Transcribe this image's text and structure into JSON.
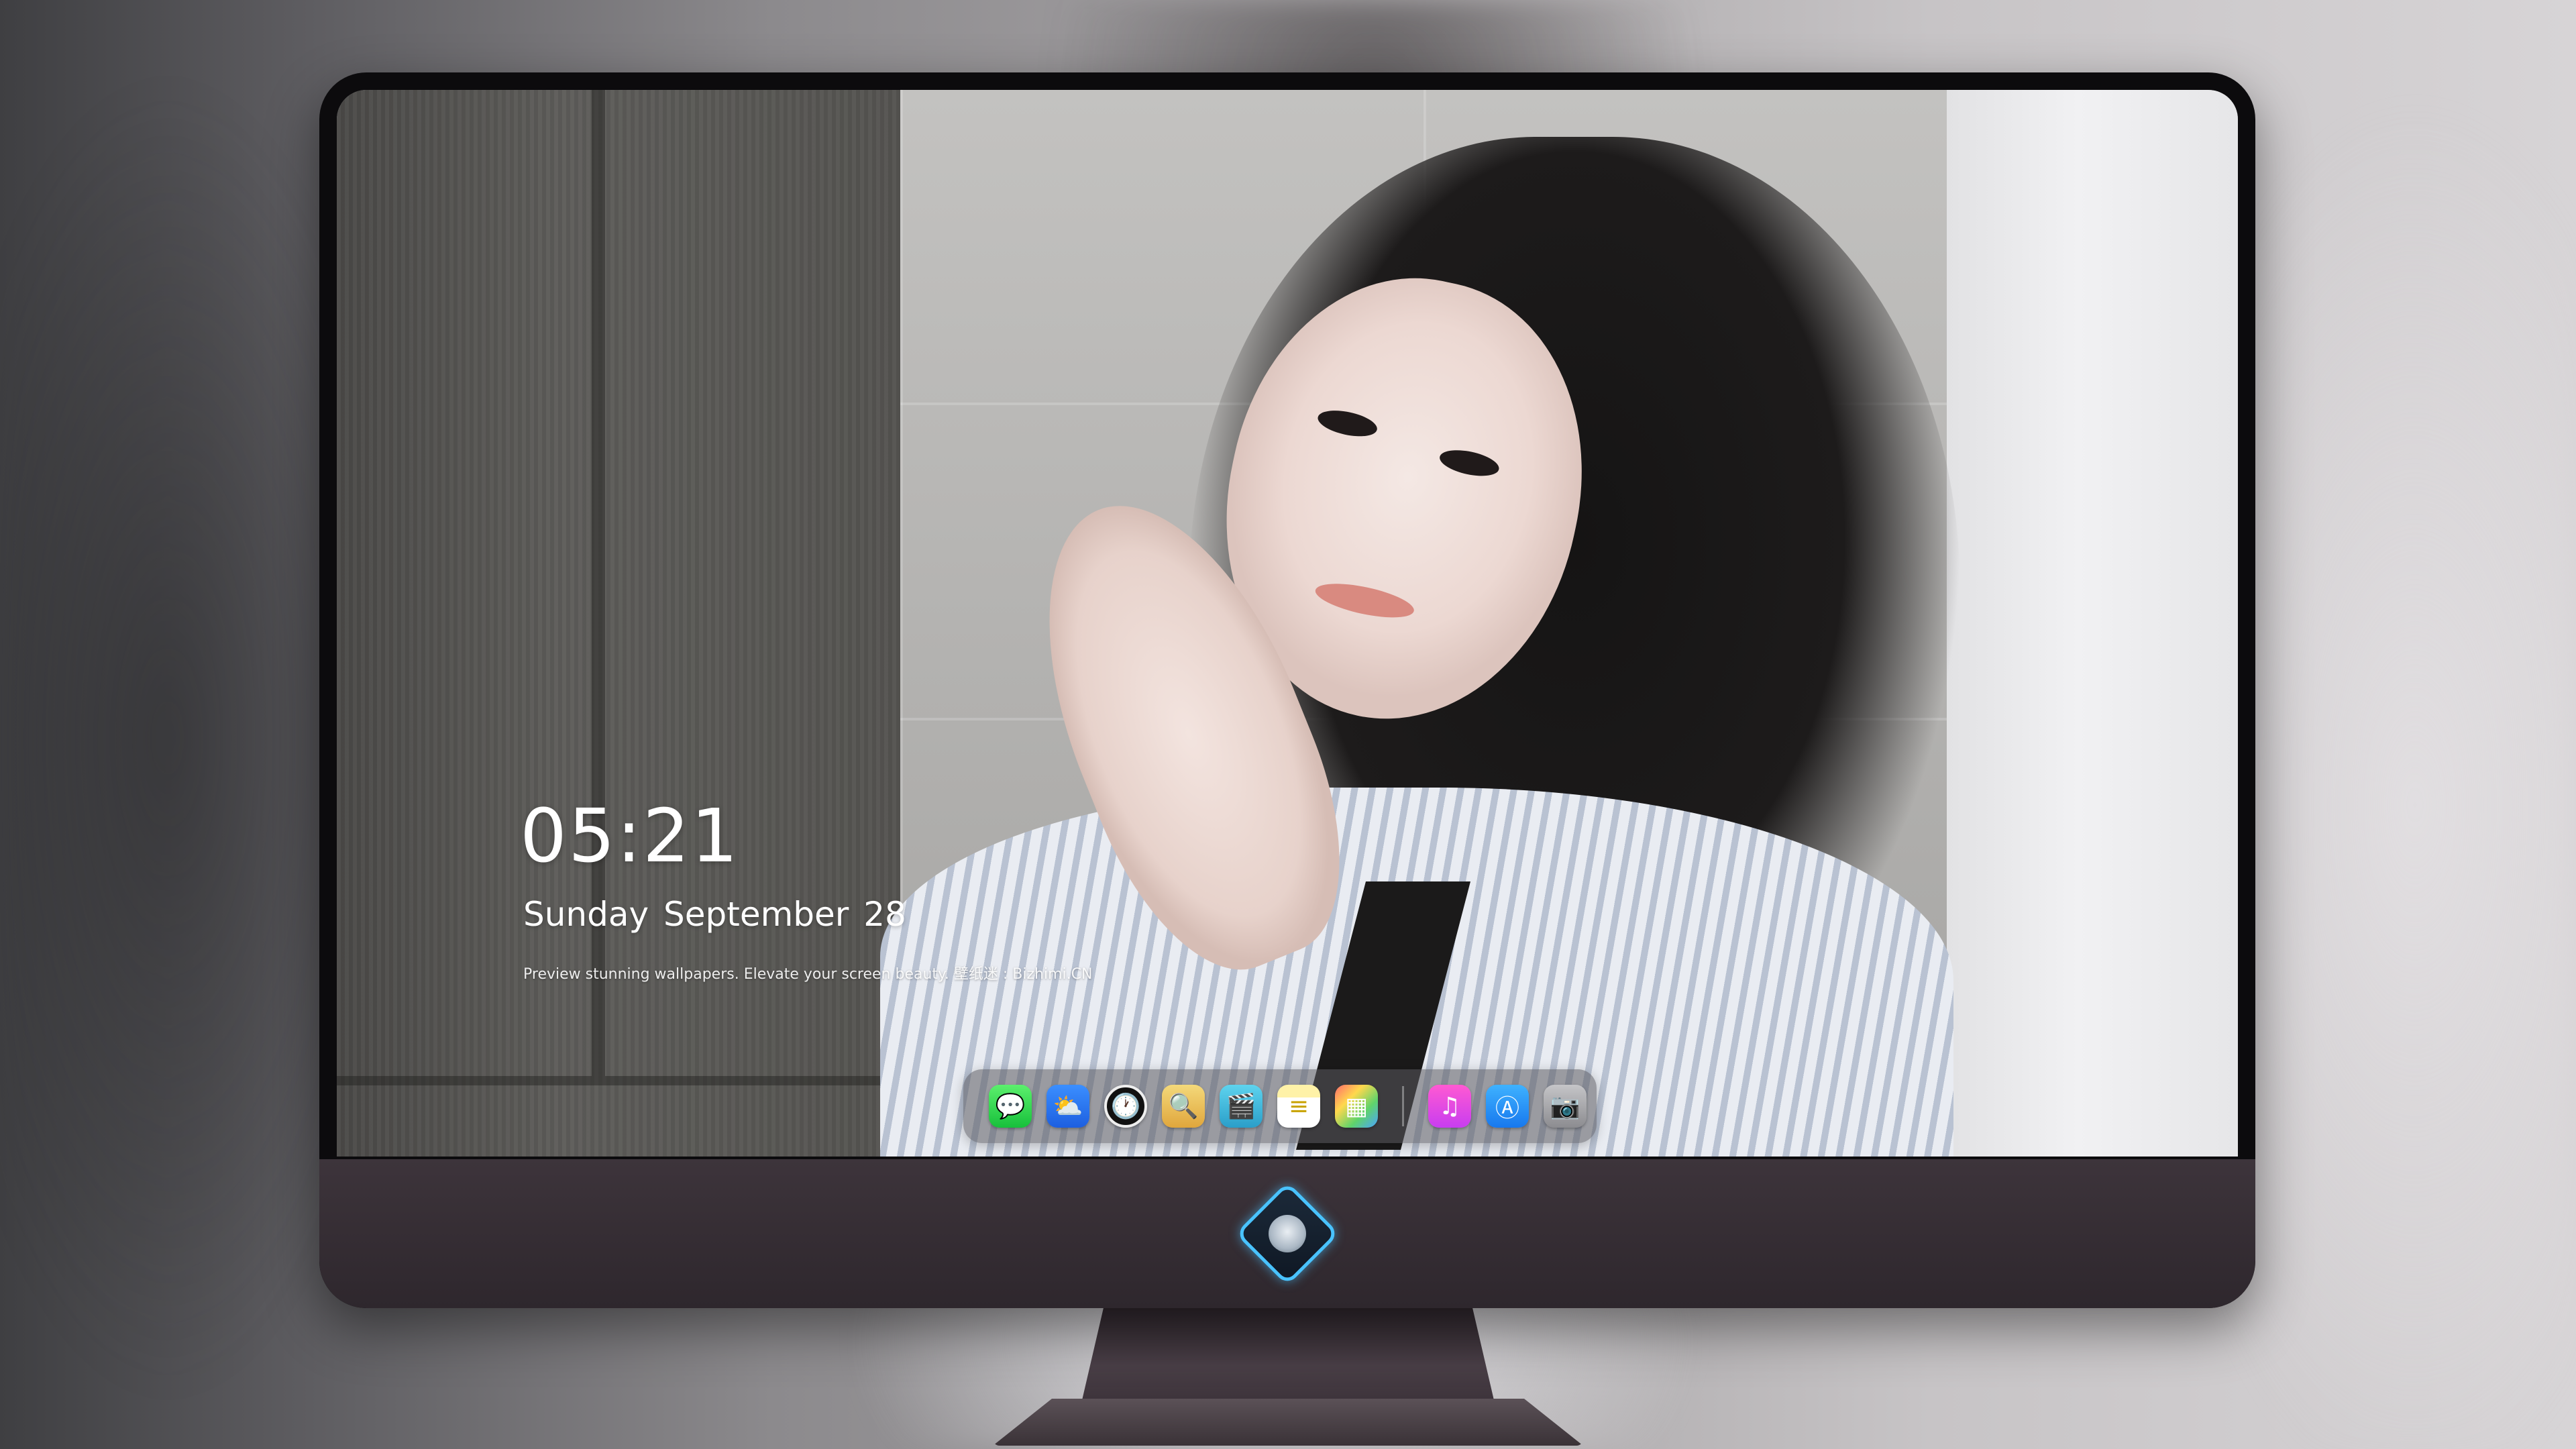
{
  "screen": {
    "time": "05:21",
    "date": "Sunday September  28",
    "tagline": "Preview stunning wallpapers. Elevate your screen beauty. 壁纸迷 : Bizhimi.CN"
  },
  "dock": {
    "apps": [
      {
        "name": "messages",
        "icon": "speech-bubble-icon",
        "glyph": "💬"
      },
      {
        "name": "weather",
        "icon": "cloud-sun-icon",
        "glyph": "⛅"
      },
      {
        "name": "clock",
        "icon": "clock-icon",
        "glyph": "🕐"
      },
      {
        "name": "preview",
        "icon": "magnifier-photo-icon",
        "glyph": "🔍"
      },
      {
        "name": "clapper",
        "icon": "clapperboard-icon",
        "glyph": "🎬"
      },
      {
        "name": "notes",
        "icon": "notepad-icon",
        "glyph": "≡"
      },
      {
        "name": "photos",
        "icon": "photo-grid-icon",
        "glyph": "▦"
      },
      {
        "name": "music",
        "icon": "music-note-icon",
        "glyph": "♫"
      },
      {
        "name": "app-store",
        "icon": "app-store-icon",
        "glyph": "Ⓐ"
      },
      {
        "name": "camera",
        "icon": "camera-icon",
        "glyph": "📷"
      }
    ]
  },
  "colors": {
    "bezel": "#0c0b0d",
    "chin": "#3d343b",
    "logo_accent": "#49c3ff"
  }
}
